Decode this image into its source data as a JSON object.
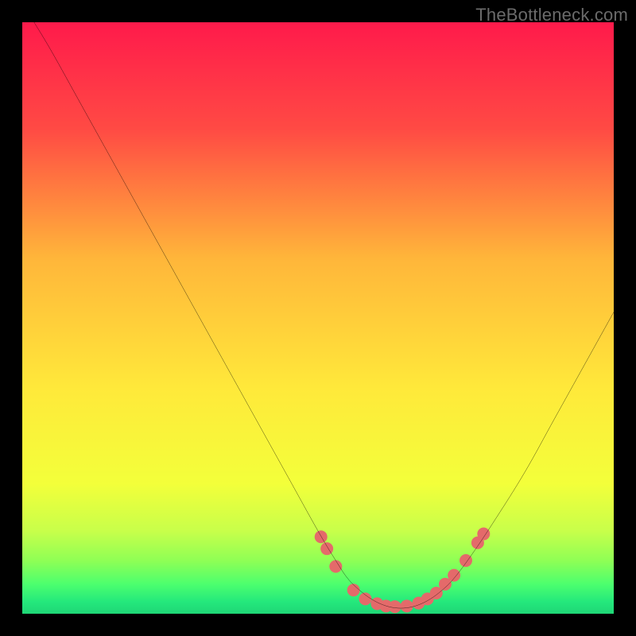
{
  "watermark": "TheBottleneck.com",
  "chart_data": {
    "type": "line",
    "title": "",
    "xlabel": "",
    "ylabel": "",
    "xlim": [
      0,
      100
    ],
    "ylim": [
      0,
      100
    ],
    "legend": false,
    "grid": false,
    "background_gradient": [
      "#ff1a4b",
      "#ff6a3c",
      "#ffd23a",
      "#f7ff3a",
      "#9dff3a",
      "#2bff7a",
      "#1fd676"
    ],
    "series": [
      {
        "name": "bottleneck-curve",
        "color": "#000000",
        "x": [
          2,
          5,
          10,
          15,
          20,
          25,
          30,
          35,
          40,
          45,
          50,
          53,
          55,
          57,
          59,
          61,
          63,
          65,
          67,
          69,
          71,
          73,
          76,
          80,
          85,
          90,
          95,
          100
        ],
        "y": [
          100,
          95,
          86,
          77,
          68,
          59,
          50,
          41,
          32,
          23,
          14,
          9,
          6,
          4,
          2.5,
          1.5,
          1,
          1,
          1.5,
          2.5,
          4,
          6,
          10,
          16,
          24,
          33,
          42,
          51
        ]
      }
    ],
    "markers": [
      {
        "name": "highlight-dots",
        "color": "#e46a6a",
        "radius": 8,
        "points": [
          {
            "x": 50.5,
            "y": 13
          },
          {
            "x": 51.5,
            "y": 11
          },
          {
            "x": 53,
            "y": 8
          },
          {
            "x": 56,
            "y": 4
          },
          {
            "x": 58,
            "y": 2.5
          },
          {
            "x": 60,
            "y": 1.7
          },
          {
            "x": 61.5,
            "y": 1.3
          },
          {
            "x": 63,
            "y": 1.2
          },
          {
            "x": 65,
            "y": 1.3
          },
          {
            "x": 67,
            "y": 1.8
          },
          {
            "x": 68.5,
            "y": 2.5
          },
          {
            "x": 70,
            "y": 3.5
          },
          {
            "x": 71.5,
            "y": 5
          },
          {
            "x": 73,
            "y": 6.5
          },
          {
            "x": 75,
            "y": 9
          },
          {
            "x": 77,
            "y": 12
          },
          {
            "x": 78,
            "y": 13.5
          }
        ]
      }
    ]
  }
}
